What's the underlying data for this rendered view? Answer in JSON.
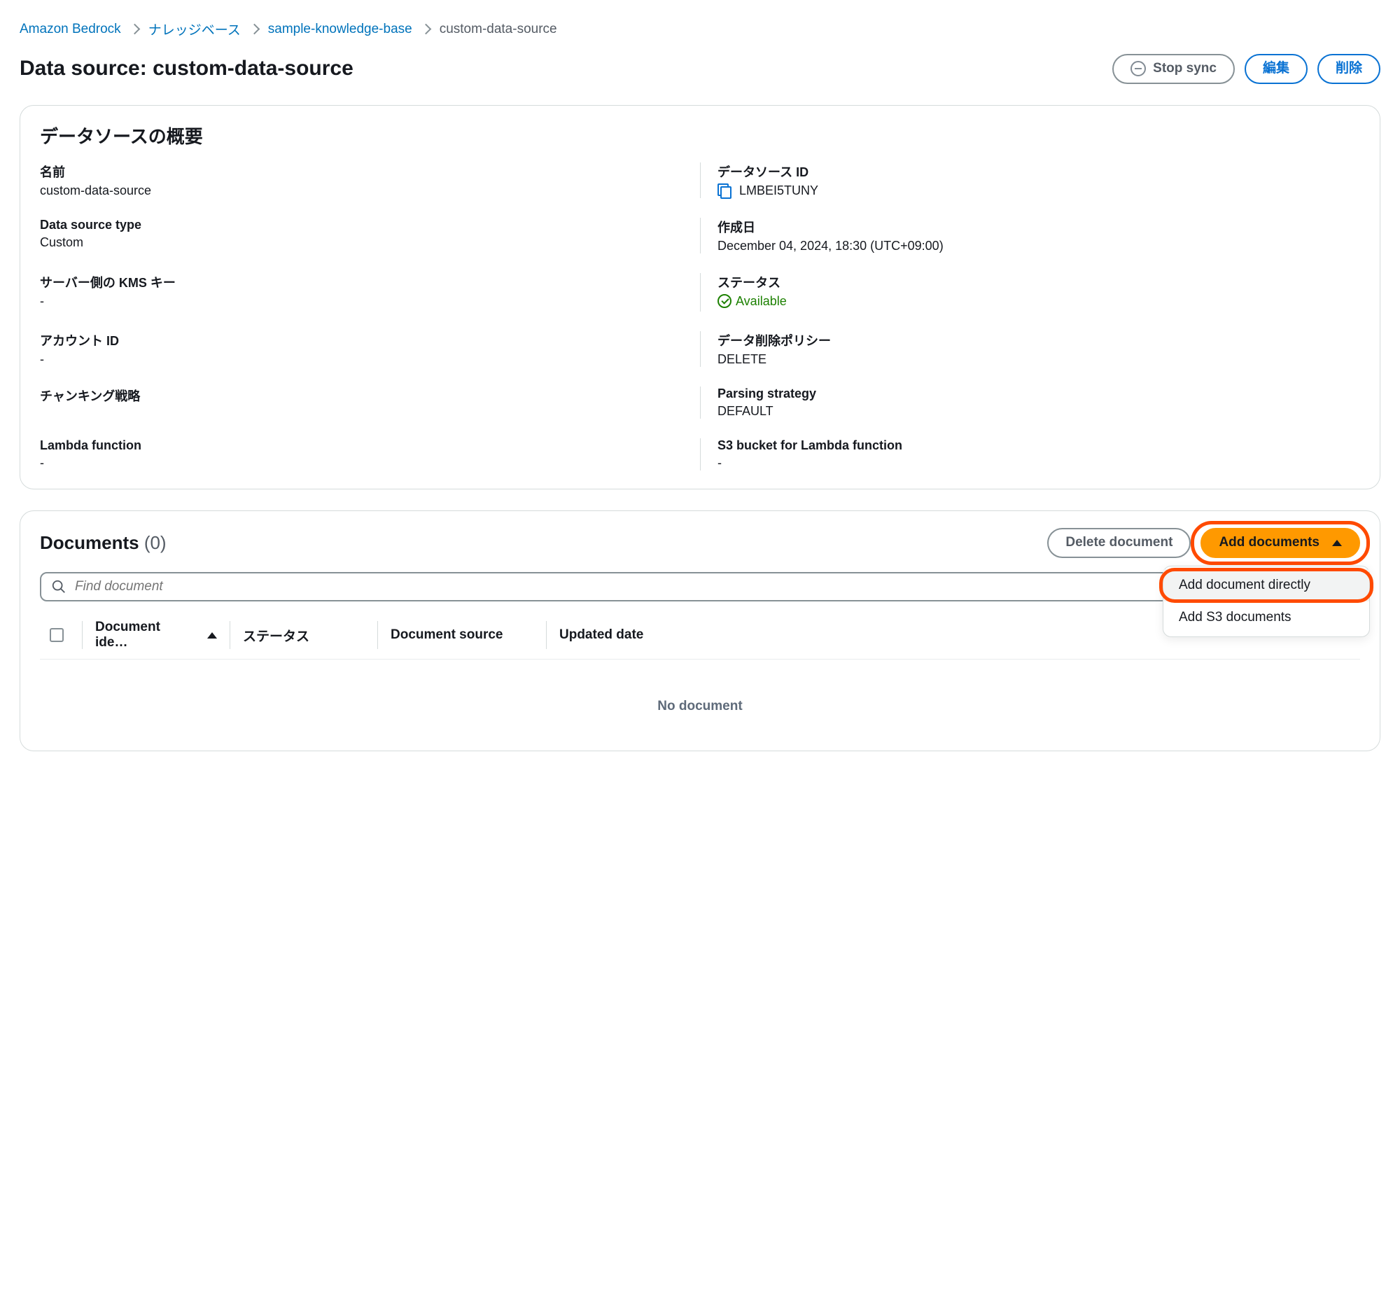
{
  "breadcrumb": {
    "items": [
      "Amazon Bedrock",
      "ナレッジベース",
      "sample-knowledge-base"
    ],
    "current": "custom-data-source"
  },
  "header": {
    "title": "Data source: custom-data-source",
    "stop_sync": "Stop sync",
    "edit": "編集",
    "delete": "削除"
  },
  "overview": {
    "title": "データソースの概要",
    "name_label": "名前",
    "name_value": "custom-data-source",
    "type_label": "Data source type",
    "type_value": "Custom",
    "kms_label": "サーバー側の KMS キー",
    "kms_value": "-",
    "account_label": "アカウント ID",
    "account_value": "-",
    "chunk_label": "チャンキング戦略",
    "chunk_value": "",
    "lambda_label": "Lambda function",
    "lambda_value": "-",
    "id_label": "データソース ID",
    "id_value": "LMBEI5TUNY",
    "created_label": "作成日",
    "created_value": "December 04, 2024, 18:30 (UTC+09:00)",
    "status_label": "ステータス",
    "status_value": "Available",
    "deletion_label": "データ削除ポリシー",
    "deletion_value": "DELETE",
    "parsing_label": "Parsing strategy",
    "parsing_value": "DEFAULT",
    "s3_label": "S3 bucket for Lambda function",
    "s3_value": "-"
  },
  "documents": {
    "title": "Documents",
    "count": "(0)",
    "delete_btn": "Delete document",
    "add_btn": "Add documents",
    "dropdown": {
      "direct": "Add document directly",
      "s3": "Add S3 documents"
    },
    "search_placeholder": "Find document",
    "columns": {
      "id": "Document ide…",
      "status": "ステータス",
      "source": "Document source",
      "updated": "Updated date"
    },
    "empty": "No document"
  }
}
